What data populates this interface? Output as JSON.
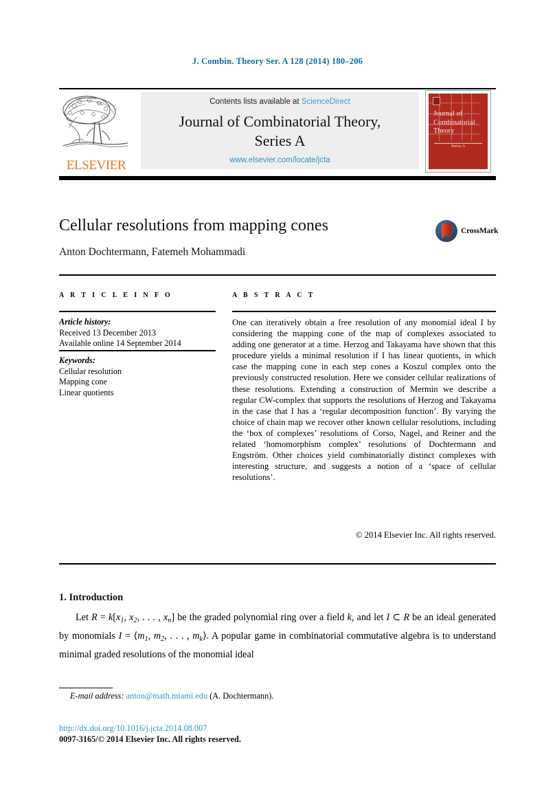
{
  "running_head": "J. Combin. Theory Ser. A 128 (2014) 180–206",
  "masthead": {
    "contents_prefix": "Contents lists available at ",
    "sciencedirect": "ScienceDirect",
    "journal_title_line1": "Journal of Combinatorial Theory,",
    "journal_title_line2": "Series A",
    "journal_url": "www.elsevier.com/locate/jcta",
    "publisher": "ELSEVIER",
    "publisher_logo_alt": "elsevier-tree-logo",
    "cover": {
      "line1": "Journal of",
      "line2": "Combinatorial",
      "line3": "Theory",
      "series": "Series A",
      "color": "#b22a1f"
    }
  },
  "article": {
    "title": "Cellular resolutions from mapping cones",
    "authors": "Anton Dochtermann, Fatemeh Mohammadi",
    "crossmark_label": "CrossMark"
  },
  "info": {
    "heading": "A R T I C L E    I N F O",
    "history_label": "Article history:",
    "history": [
      "Received 13 December 2013",
      "Available online 14 September 2014"
    ],
    "keywords_label": "Keywords:",
    "keywords": [
      "Cellular resolution",
      "Mapping cone",
      "Linear quotients"
    ]
  },
  "abstract": {
    "heading": "A B S T R A C T",
    "text": "One can iteratively obtain a free resolution of any monomial ideal I by considering the mapping cone of the map of complexes associated to adding one generator at a time. Herzog and Takayama have shown that this procedure yields a minimal resolution if I has linear quotients, in which case the mapping cone in each step cones a Koszul complex onto the previously constructed resolution. Here we consider cellular realizations of these resolutions. Extending a construction of Mermin we describe a regular CW-complex that supports the resolutions of Herzog and Takayama in the case that I has a ‘regular decomposition function’. By varying the choice of chain map we recover other known cellular resolutions, including the ‘box of complexes’ resolutions of Corso, Nagel, and Reiner and the related ‘homomorphism complex’ resolutions of Dochtermann and Engström. Other choices yield combinatorially distinct complexes with interesting structure, and suggests a notion of a ‘space of cellular resolutions’.",
    "copyright": "© 2014 Elsevier Inc. All rights reserved."
  },
  "body": {
    "section_number_title": "1.  Introduction",
    "paragraph_html": "Let <i>R</i> = <i>k</i>[<i>x</i><span class=\"sub\">1</span>, <i>x</i><span class=\"sub\">2</span>, . . . , <i>x</i><span class=\"sub\">n</span>] be the graded polynomial ring over a field <i>k</i>, and let <i>I</i> ⊂ <i>R</i> be an ideal generated by monomials <i>I</i> = ⟨<i>m</i><span class=\"sub\">1</span>, <i>m</i><span class=\"sub\">2</span>, . . . , <i>m</i><span class=\"sub\">k</span>⟩. A popular game in combinatorial commutative algebra is to understand minimal graded resolutions of the monomial ideal"
  },
  "footer": {
    "email_label": "E-mail address:",
    "email": "anton@math.miami.edu",
    "email_suffix": "(A. Dochtermann).",
    "doi": "http://dx.doi.org/10.1016/j.jcta.2014.08.007",
    "issn_line": "0097-3165/© 2014 Elsevier Inc. All rights reserved."
  },
  "colors": {
    "link_blue": "#2f93c8",
    "header_blue": "#0a6ea1",
    "elsevier_orange": "#E87722",
    "cover_red": "#b22a1f"
  }
}
